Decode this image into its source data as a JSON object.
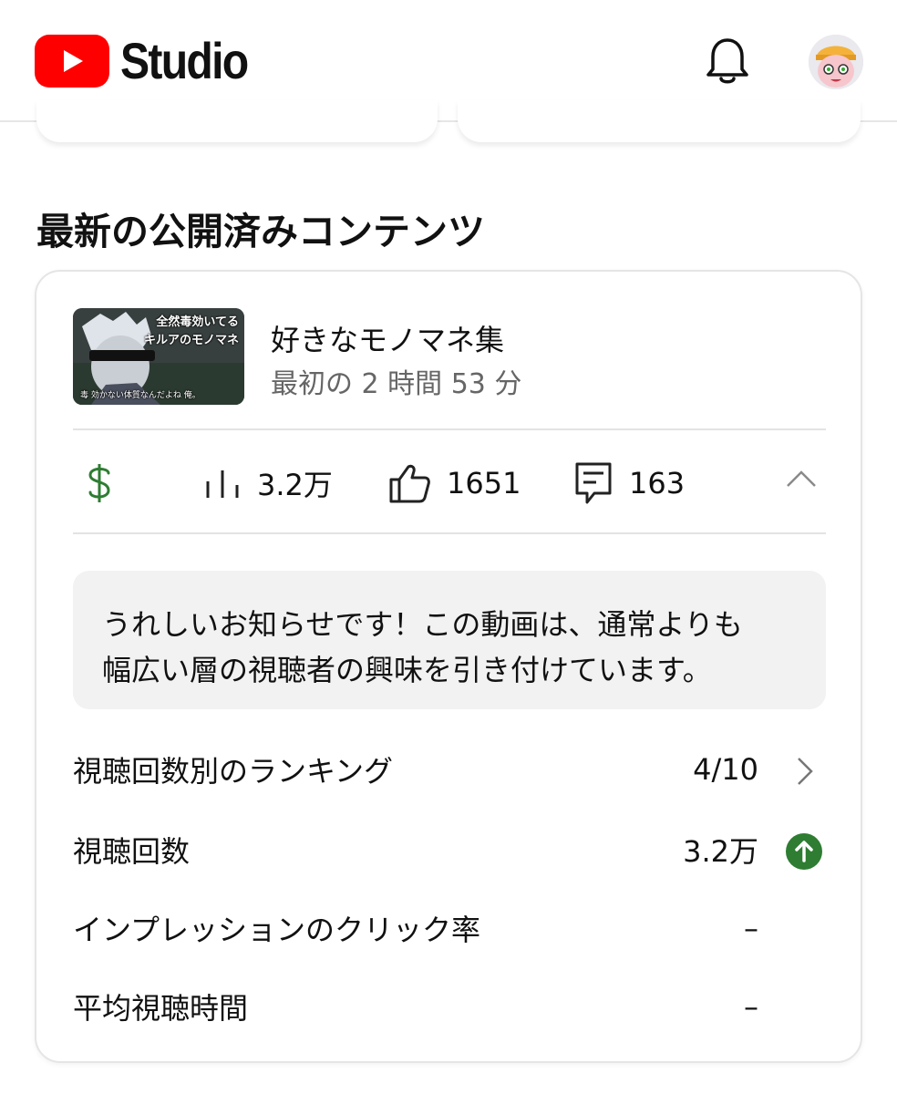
{
  "header": {
    "app_title": "Studio",
    "icons": {
      "logo": "youtube-play-logo",
      "notifications": "bell-icon",
      "account": "avatar"
    },
    "accent": "#ff0000"
  },
  "section": {
    "title": "最新の公開済みコンテンツ"
  },
  "video": {
    "thumbnail_caption_line1": "全然毒効いてる",
    "thumbnail_caption_line2": "キルアのモノマネ",
    "thumbnail_subtitle": "毒 効かない体質なんだよね 俺。",
    "title": "好きなモノマネ集",
    "period": "最初の 2 時間 53 分"
  },
  "stats": {
    "monetization_icon": "dollar-icon",
    "monetization_color": "#2e7d32",
    "views": "3.2万",
    "likes": "1651",
    "comments": "163",
    "expand_icon": "chevron-up-icon"
  },
  "notice": {
    "line1": "うれしいお知らせです！この動画は、通常よりも",
    "line2": "幅広い層の視聴者の興味を引き付けています。"
  },
  "metrics": [
    {
      "label": "視聴回数別のランキング",
      "value": "4/10",
      "trail_icon": "chevron-right-icon"
    },
    {
      "label": "視聴回数",
      "value": "3.2万",
      "trail_icon": "arrow-up-circle-icon",
      "trail_color": "#2e7d32"
    },
    {
      "label": "インプレッションのクリック率",
      "value": "–"
    },
    {
      "label": "平均視聴時間",
      "value": "–"
    }
  ]
}
